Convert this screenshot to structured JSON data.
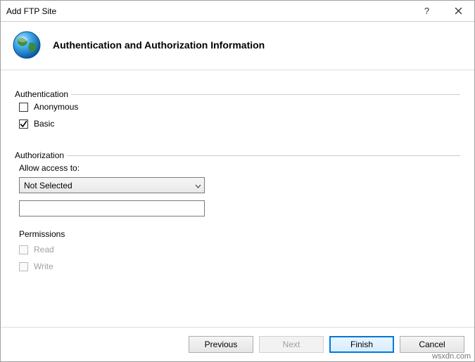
{
  "titlebar": {
    "title": "Add FTP Site",
    "help": "?",
    "close": "×"
  },
  "header": {
    "title": "Authentication and Authorization Information"
  },
  "auth_group": {
    "label": "Authentication",
    "anonymous": {
      "label": "Anonymous",
      "checked": false
    },
    "basic": {
      "label": "Basic",
      "checked": true
    }
  },
  "authz_group": {
    "label": "Authorization",
    "allow_label": "Allow access to:",
    "dropdown_value": "Not Selected",
    "textbox_value": "",
    "permissions_label": "Permissions",
    "read": {
      "label": "Read",
      "checked": false,
      "enabled": false
    },
    "write": {
      "label": "Write",
      "checked": false,
      "enabled": false
    }
  },
  "footer": {
    "previous": "Previous",
    "next": "Next",
    "finish": "Finish",
    "cancel": "Cancel"
  },
  "watermark": "wsxdn.com"
}
